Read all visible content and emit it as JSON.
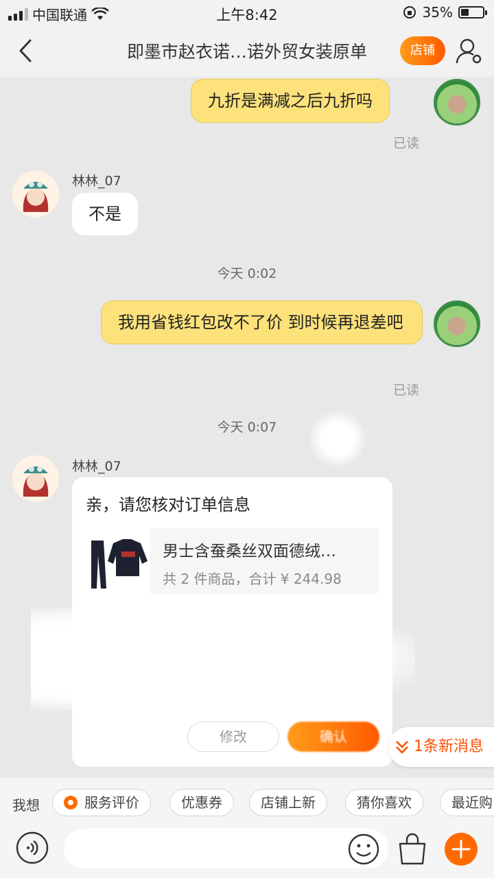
{
  "status_bar": {
    "carrier": "中国联通",
    "time": "上午8:42",
    "battery": "35%",
    "battery_level": 0.35
  },
  "nav": {
    "title": "即墨市赵衣诺…诺外贸女装原单",
    "shop_label": "店铺"
  },
  "messages": [
    {
      "sender": "self",
      "text": "九折是满减之后九折吗",
      "read": "已读"
    },
    {
      "sender": "other",
      "nickname": "林林_07",
      "text": "不是"
    },
    {
      "time": "今天 0:02"
    },
    {
      "sender": "self",
      "text": "我用省钱红包改不了价 到时候再退差吧",
      "read": "已读"
    },
    {
      "time": "今天 0:07"
    },
    {
      "sender": "other",
      "nickname": "林林_07",
      "card": true
    }
  ],
  "order_card": {
    "title": "亲，请您核对订单信息",
    "product_name": "男士含蚕桑丝双面德绒…",
    "summary": "共 2 件商品，合计 ¥ 244.98",
    "modify_label": "修改",
    "confirm_label": "确认"
  },
  "new_message_label": "1条新消息",
  "quick_bar": {
    "label": "我想",
    "chips": [
      "服务评价",
      "优惠券",
      "店铺上新",
      "猜你喜欢",
      "最近购"
    ]
  },
  "input": {
    "placeholder": ""
  },
  "colors": {
    "accent": "#ff6a00",
    "bubble_self": "#fde27c",
    "background": "#e8e8e8"
  }
}
